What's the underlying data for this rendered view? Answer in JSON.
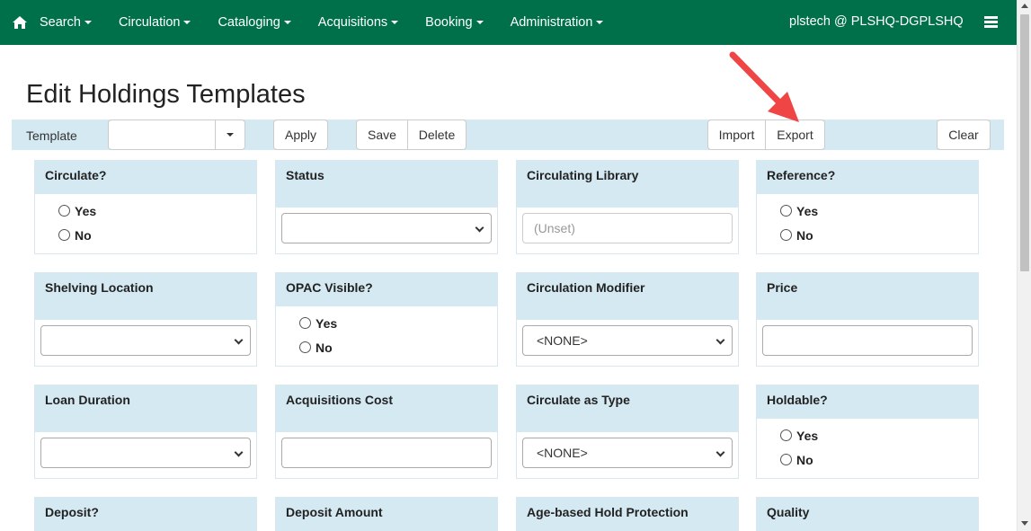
{
  "navbar": {
    "menus": [
      {
        "label": "Search"
      },
      {
        "label": "Circulation"
      },
      {
        "label": "Cataloging"
      },
      {
        "label": "Acquisitions"
      },
      {
        "label": "Booking"
      },
      {
        "label": "Administration"
      }
    ],
    "user": "plstech @ PLSHQ-DGPLSHQ",
    "home_icon": "home-icon",
    "menu_icon": "hamburger-icon"
  },
  "page": {
    "title": "Edit Holdings Templates"
  },
  "toolbar": {
    "template_label": "Template",
    "template_value": "",
    "apply": "Apply",
    "save": "Save",
    "delete": "Delete",
    "import": "Import",
    "export": "Export",
    "clear": "Clear"
  },
  "fields": {
    "circulate": {
      "label": "Circulate?",
      "yes": "Yes",
      "no": "No"
    },
    "status": {
      "label": "Status",
      "value": ""
    },
    "circulating_library": {
      "label": "Circulating Library",
      "placeholder": "(Unset)"
    },
    "reference": {
      "label": "Reference?",
      "yes": "Yes",
      "no": "No"
    },
    "shelving_location": {
      "label": "Shelving Location",
      "value": ""
    },
    "opac_visible": {
      "label": "OPAC Visible?",
      "yes": "Yes",
      "no": "No"
    },
    "circulation_modifier": {
      "label": "Circulation Modifier",
      "value": "<NONE>"
    },
    "price": {
      "label": "Price",
      "value": ""
    },
    "loan_duration": {
      "label": "Loan Duration",
      "value": ""
    },
    "acquisitions_cost": {
      "label": "Acquisitions Cost",
      "value": ""
    },
    "circulate_as_type": {
      "label": "Circulate as Type",
      "value": "<NONE>"
    },
    "holdable": {
      "label": "Holdable?",
      "yes": "Yes",
      "no": "No"
    },
    "deposit": {
      "label": "Deposit?"
    },
    "deposit_amount": {
      "label": "Deposit Amount"
    },
    "age_hold_protection": {
      "label": "Age-based Hold Protection"
    },
    "quality": {
      "label": "Quality"
    }
  },
  "colors": {
    "navbar": "#00704a",
    "panel": "#d5e9f2",
    "arrow": "#ef4545"
  }
}
